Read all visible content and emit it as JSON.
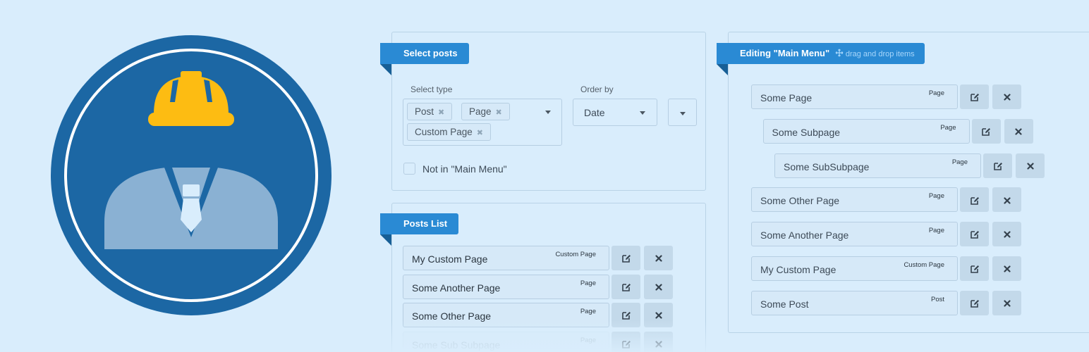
{
  "colors": {
    "background": "#d9edfc",
    "accent": "#2a8ad4",
    "logo_blue": "#1c67a4",
    "helmet": "#fdbc12",
    "body_fill": "#8ab1d3"
  },
  "logo": {
    "icon": "construction-worker-icon"
  },
  "select_posts": {
    "title": "Select posts",
    "select_type_label": "Select type",
    "tags": [
      "Post",
      "Page",
      "Custom Page"
    ],
    "tag_remove_glyph": "✖",
    "order_by_label": "Order by",
    "order_by_value": "Date",
    "checkbox_label": "Not in \"Main Menu\""
  },
  "posts_list": {
    "title": "Posts List",
    "items": [
      {
        "title": "My Custom Page",
        "type": "Custom Page"
      },
      {
        "title": "Some Another Page",
        "type": "Page"
      },
      {
        "title": "Some Other Page",
        "type": "Page"
      },
      {
        "title": "Some Sub Subpage",
        "type": "Page"
      }
    ]
  },
  "menu_editor": {
    "title": "Editing \"Main Menu\"",
    "hint": "drag and drop items",
    "items": [
      {
        "title": "Some Page",
        "type": "Page",
        "depth": 0
      },
      {
        "title": "Some Subpage",
        "type": "Page",
        "depth": 1
      },
      {
        "title": "Some SubSubpage",
        "type": "Page",
        "depth": 2
      },
      {
        "title": "Some Other Page",
        "type": "Page",
        "depth": 0
      },
      {
        "title": "Some Another Page",
        "type": "Page",
        "depth": 0
      },
      {
        "title": "My Custom Page",
        "type": "Custom Page",
        "depth": 0
      },
      {
        "title": "Some Post",
        "type": "Post",
        "depth": 0
      }
    ]
  },
  "icons": {
    "edit": "edit-icon",
    "remove": "close-icon",
    "drag": "drag-hand-icon"
  }
}
